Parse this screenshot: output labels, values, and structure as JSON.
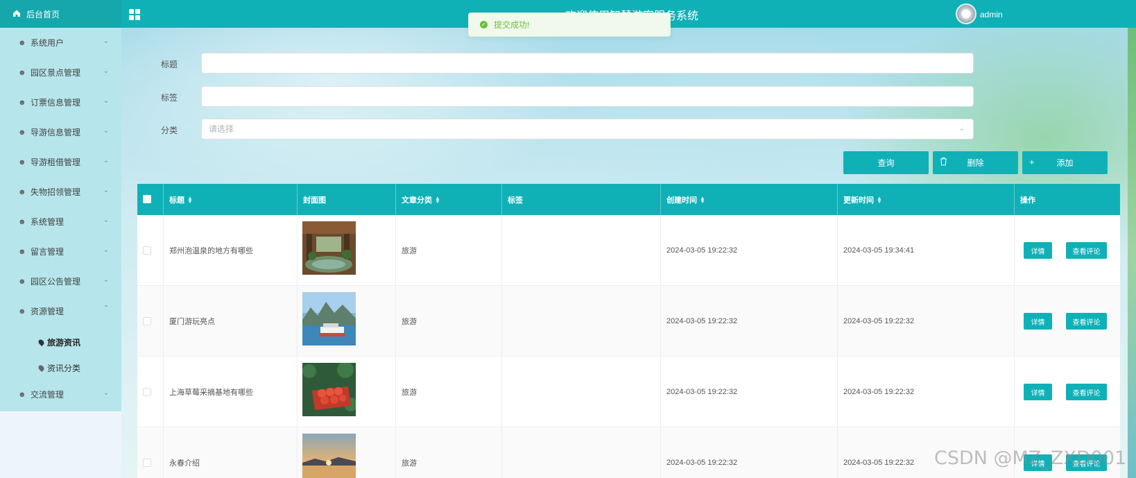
{
  "topbar": {
    "home_label": "后台首页",
    "title": "欢迎使用智慧游客服务系统",
    "username": "admin"
  },
  "toast": {
    "message": "提交成功!"
  },
  "sidebar": {
    "items": [
      {
        "label": "系统用户",
        "expanded": false
      },
      {
        "label": "园区景点管理",
        "expanded": false
      },
      {
        "label": "订票信息管理",
        "expanded": false
      },
      {
        "label": "导游信息管理",
        "expanded": false
      },
      {
        "label": "导游租借管理",
        "expanded": false
      },
      {
        "label": "失物招领管理",
        "expanded": false
      },
      {
        "label": "系统管理",
        "expanded": false
      },
      {
        "label": "留言管理",
        "expanded": false
      },
      {
        "label": "园区公告管理",
        "expanded": false
      },
      {
        "label": "资源管理",
        "expanded": true
      },
      {
        "label": "交流管理",
        "expanded": false
      }
    ],
    "sub_items": [
      {
        "label": "旅游资讯",
        "active": true
      },
      {
        "label": "资讯分类",
        "active": false
      }
    ]
  },
  "search": {
    "title_label": "标题",
    "title_value": "",
    "tag_label": "标签",
    "tag_value": "",
    "category_label": "分类",
    "category_placeholder": "请选择"
  },
  "actions": {
    "query": "查询",
    "delete": "删除",
    "add": "添加"
  },
  "table": {
    "columns": [
      "标题",
      "封面图",
      "文章分类",
      "标签",
      "创建时间",
      "更新时间",
      "操作"
    ],
    "rows": [
      {
        "title": "郑州泡温泉的地方有哪些",
        "category": "旅游",
        "tag": "",
        "created": "2024-03-05 19:22:32",
        "updated": "2024-03-05 19:34:41",
        "thumb": "hot-spring"
      },
      {
        "title": "厦门游玩亮点",
        "category": "旅游",
        "tag": "",
        "created": "2024-03-05 19:22:32",
        "updated": "2024-03-05 19:22:32",
        "thumb": "boat-harbor"
      },
      {
        "title": "上海草莓采摘基地有哪些",
        "category": "旅游",
        "tag": "",
        "created": "2024-03-05 19:22:32",
        "updated": "2024-03-05 19:22:32",
        "thumb": "strawberries"
      },
      {
        "title": "永春介绍",
        "category": "旅游",
        "tag": "",
        "created": "2024-03-05 19:22:32",
        "updated": "2024-03-05 19:22:32",
        "thumb": "sunset-lake"
      }
    ],
    "row_actions": {
      "detail": "详情",
      "comments": "查看评论"
    }
  },
  "watermark": "CSDN @MZ_ZXD001",
  "colors": {
    "primary": "#0fb1b7",
    "sidebar": "#b6e6ec",
    "success": "#67c23a"
  }
}
